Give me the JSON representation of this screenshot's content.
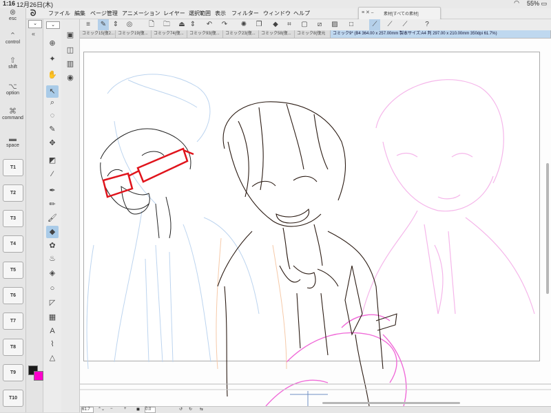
{
  "status_bar": {
    "time": "1:16",
    "date": "12月26日(木)",
    "battery": "55%",
    "wifi_icon": "wifi-icon"
  },
  "edge_keys": {
    "esc": "esc",
    "control": "control",
    "shift": "shift",
    "option": "option",
    "command": "command",
    "space": "space",
    "t_keys": [
      "T1",
      "T2",
      "T3",
      "T4",
      "T5",
      "T6",
      "T7",
      "T8",
      "T9",
      "T10"
    ]
  },
  "menu": {
    "logo": "ᘐ",
    "items": [
      "ファイル",
      "編集",
      "ページ管理",
      "アニメーション",
      "レイヤー",
      "選択範囲",
      "表示",
      "フィルター",
      "ウィンドウ",
      "ヘルプ"
    ]
  },
  "floating_palette": {
    "controls": "≡ ✕ ⎯",
    "title": "素材[すべての素材]"
  },
  "tabs": [
    {
      "label": "コミック15(復2...",
      "active": false
    },
    {
      "label": "コミック19(復...",
      "active": false
    },
    {
      "label": "コミック74(復...",
      "active": false
    },
    {
      "label": "コミック93(復...",
      "active": false
    },
    {
      "label": "コミック23(復...",
      "active": false
    },
    {
      "label": "コミック58(復...",
      "active": false
    },
    {
      "label": "コミック8(復元",
      "active": false
    },
    {
      "label": "コミック9* (B4 364.00 x 257.00mm 製本サイズ:A4 判 297.00 x 210.00mm 350dpi 61.7%)",
      "active": true
    }
  ],
  "bottom_bar": {
    "zoom": "61.7",
    "angle": "0.0"
  },
  "colors": {
    "main_color": "#1a1a1a",
    "sub_color": "#ff00cc",
    "active_tool_bg": "#a9cbe8",
    "glasses_red": "#e0141c"
  }
}
